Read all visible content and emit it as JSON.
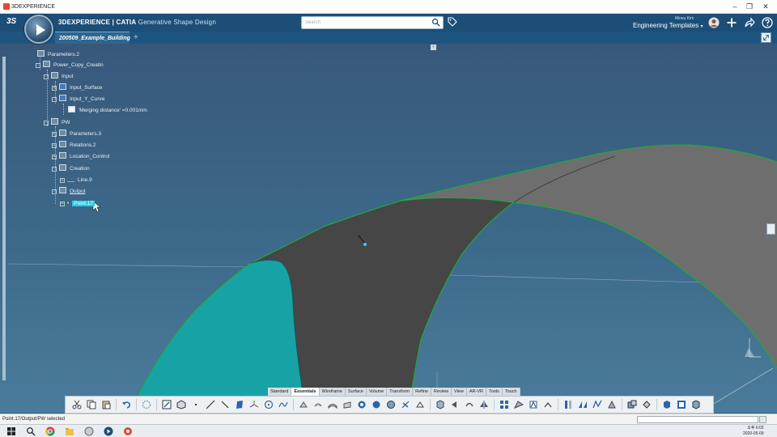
{
  "window": {
    "title": "3DEXPERIENCE",
    "minimize": "–",
    "maximize": "❐",
    "close": "✕"
  },
  "header": {
    "ds_logo": "3S",
    "brand": "3DEXPERIENCE | CATIA",
    "app_name": "Generative Shape Design",
    "search_placeholder": "Search",
    "user_name": "Minsu Kim",
    "collab_space": "Engineering Templates",
    "icons": [
      "search-icon",
      "tag-icon",
      "avatar-icon",
      "plus-icon",
      "share-icon",
      "help-icon"
    ]
  },
  "tabs": {
    "active": "200509_Example_Building",
    "add": "+"
  },
  "tree": {
    "nodes": [
      {
        "label": "Parameters.2",
        "indent": 0
      },
      {
        "label": "Power_Copy_Creatin",
        "indent": 0
      },
      {
        "label": "Input",
        "indent": 1
      },
      {
        "label": "Input_Surface",
        "indent": 2
      },
      {
        "label": "Input_Y_Curve",
        "indent": 2
      },
      {
        "label": "'Merging distance' =0.001mm",
        "indent": 3
      },
      {
        "label": "PW",
        "indent": 1
      },
      {
        "label": "Parameters.3",
        "indent": 2
      },
      {
        "label": "Relations.2",
        "indent": 2
      },
      {
        "label": "Location_Control",
        "indent": 2
      },
      {
        "label": "Creation",
        "indent": 2
      },
      {
        "label": "Line.9",
        "indent": 3
      },
      {
        "label": "Output",
        "indent": 2
      },
      {
        "label": "Point.17",
        "indent": 3
      }
    ]
  },
  "action_bar": {
    "tabs": [
      "Standard",
      "Essentials",
      "Wireframe",
      "Surface",
      "Volume",
      "Transform",
      "Refine",
      "Review",
      "View",
      "AR-VR",
      "Tools",
      "Touch"
    ],
    "active_tab": "Essentials"
  },
  "status": {
    "message": "Point.17/Output/PW selected"
  },
  "taskbar": {
    "time": "오후 6:02",
    "date": "2020-05-09"
  },
  "colors": {
    "header": "#1c4e77",
    "viewport": "#3d6a8a",
    "surface_dark": "#4a4a4a",
    "surface_grey": "#6d6d6d",
    "surface_cyan": "#16a3a6",
    "edge": "#1faa3a",
    "selection": "#20d0e8"
  }
}
